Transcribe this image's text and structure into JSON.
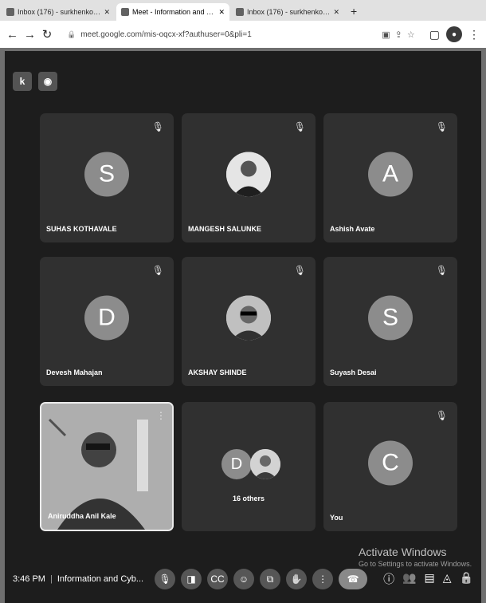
{
  "browser": {
    "tabs": [
      {
        "label": "Inbox (176) - surkhenkojmaill..."
      },
      {
        "label": "Meet - Information and Cyb..."
      },
      {
        "label": "Inbox (176) - surkhenkojmaill..."
      }
    ],
    "url": "meet.google.com/mis-oqcx-xf?authuser=0&pli=1"
  },
  "meeting": {
    "time": "3:46 PM",
    "title": "Information and Cyb...",
    "tiles": [
      {
        "initial": "S",
        "name": "SUHAS KOTHAVALE",
        "type": "letter"
      },
      {
        "initial": "",
        "name": "MANGESH SALUNKE",
        "type": "photo"
      },
      {
        "initial": "A",
        "name": "Ashish Avate",
        "type": "letter"
      },
      {
        "initial": "D",
        "name": "Devesh Mahajan",
        "type": "letter"
      },
      {
        "initial": "",
        "name": "AKSHAY SHINDE",
        "type": "photo"
      },
      {
        "initial": "S",
        "name": "Suyash Desai",
        "type": "letter"
      },
      {
        "initial": "",
        "name": "Aniruddha Anil Kale",
        "type": "video"
      },
      {
        "initial": "D",
        "name": "16 others",
        "type": "others"
      },
      {
        "initial": "C",
        "name": "You",
        "type": "letter"
      }
    ],
    "controls": {
      "participants_count": "16",
      "captions_label": "CC"
    }
  },
  "watermark": {
    "title": "Activate Windows",
    "subtitle": "Go to Settings to activate Windows."
  },
  "colors": {
    "tile_bg": "#3a3a3a",
    "page_bg": "#2a2a2a",
    "avatar_bg": "#8a8a8a"
  }
}
